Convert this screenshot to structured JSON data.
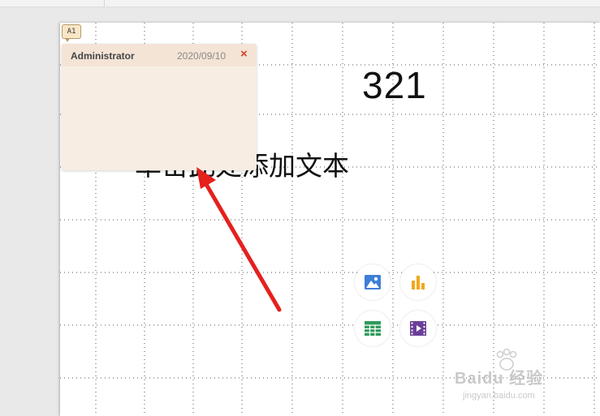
{
  "slide": {
    "number_text": "321",
    "body_text": "单击此处添加文本"
  },
  "comment": {
    "marker_label": "A1",
    "author": "Administrator",
    "date": "2020/09/10",
    "close_symbol": "×",
    "body": ""
  },
  "insert_buttons": [
    {
      "name": "insert-picture-button",
      "icon": "picture-icon"
    },
    {
      "name": "insert-chart-button",
      "icon": "chart-icon"
    },
    {
      "name": "insert-table-button",
      "icon": "table-icon"
    },
    {
      "name": "insert-video-button",
      "icon": "video-icon"
    }
  ],
  "watermark": {
    "main": "Baidu 经验",
    "sub": "jingyan.baidu.com"
  },
  "colors": {
    "annotation_arrow": "#e5201d",
    "comment_background": "#f7ede3",
    "close_icon": "#d7432e"
  }
}
